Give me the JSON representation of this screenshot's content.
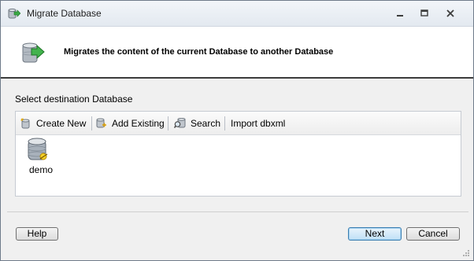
{
  "window": {
    "title": "Migrate Database"
  },
  "header": {
    "description": "Migrates the content of the current Database to another Database"
  },
  "content": {
    "select_label": "Select destination Database"
  },
  "toolbar": {
    "create_new": "Create New",
    "add_existing": "Add Existing",
    "search": "Search",
    "import_dbxml": "Import dbxml"
  },
  "databases": [
    {
      "label": "demo",
      "icon": "database-icon"
    }
  ],
  "footer": {
    "help": "Help",
    "next": "Next",
    "cancel": "Cancel"
  },
  "colors": {
    "accent": "#3c7fb1",
    "database_icon": "#9aa3ad"
  }
}
